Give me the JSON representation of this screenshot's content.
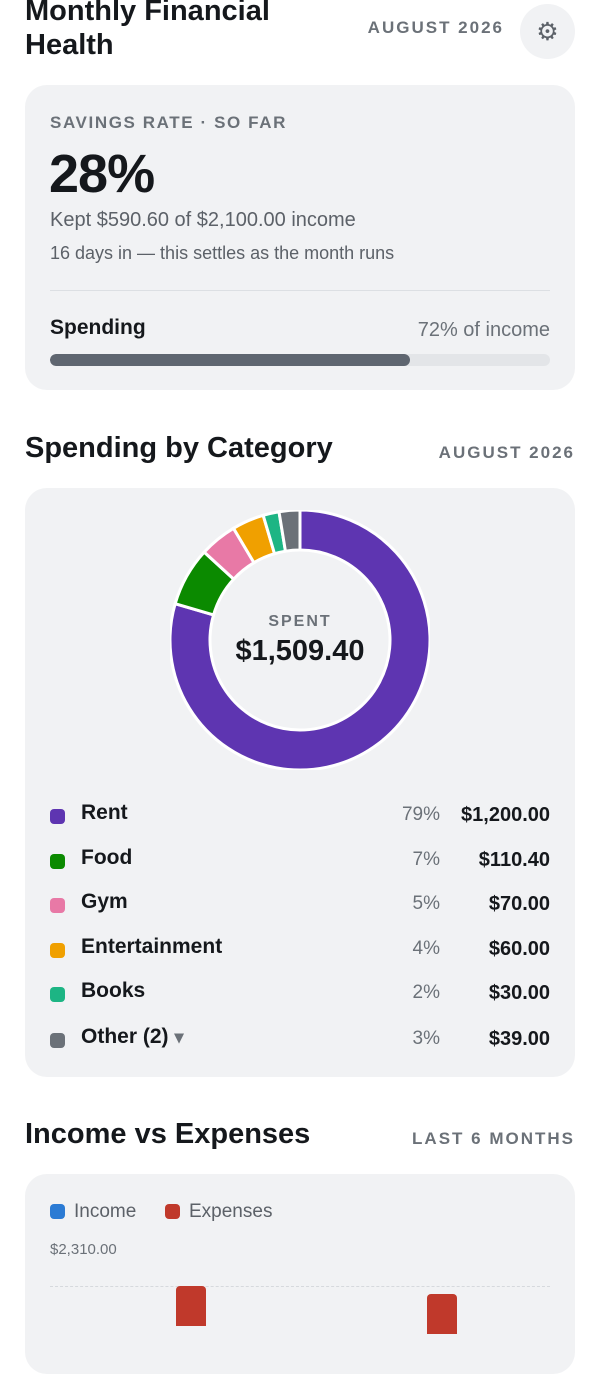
{
  "header": {
    "title": "Monthly Financial Health",
    "period": "AUGUST 2026",
    "settings_icon": "gear-icon"
  },
  "savings": {
    "eyebrow": "SAVINGS RATE · SO FAR",
    "rate": "28%",
    "kept_text": "Kept $590.60 of $2,100.00 income",
    "days_text": "16 days in — this settles as the month runs",
    "spending_label": "Spending",
    "spending_pct_text": "72% of income",
    "spending_fraction": 0.72
  },
  "category_section": {
    "title": "Spending by Category",
    "period": "AUGUST 2026",
    "spent_label": "SPENT",
    "spent_total": "$1,509.40",
    "items": [
      {
        "name": "Rent",
        "pct": "79%",
        "amount": "$1,200.00",
        "value": 1200.0,
        "color": "#5e35b1"
      },
      {
        "name": "Food",
        "pct": "7%",
        "amount": "$110.40",
        "value": 110.4,
        "color": "#0b8a00"
      },
      {
        "name": "Gym",
        "pct": "5%",
        "amount": "$70.00",
        "value": 70.0,
        "color": "#e879a6"
      },
      {
        "name": "Entertainment",
        "pct": "4%",
        "amount": "$60.00",
        "value": 60.0,
        "color": "#f0a000"
      },
      {
        "name": "Books",
        "pct": "2%",
        "amount": "$30.00",
        "value": 30.0,
        "color": "#1db584"
      },
      {
        "name": "Other (2)",
        "pct": "3%",
        "amount": "$39.00",
        "value": 39.0,
        "color": "#6b7178",
        "caret": "▾"
      }
    ]
  },
  "income_section": {
    "title": "Income vs Expenses",
    "period": "LAST 6 MONTHS",
    "legend_income": "Income",
    "legend_expenses": "Expenses",
    "income_color": "#2b7bd4",
    "expenses_color": "#c0392b",
    "y_max_label": "$2,310.00"
  }
}
